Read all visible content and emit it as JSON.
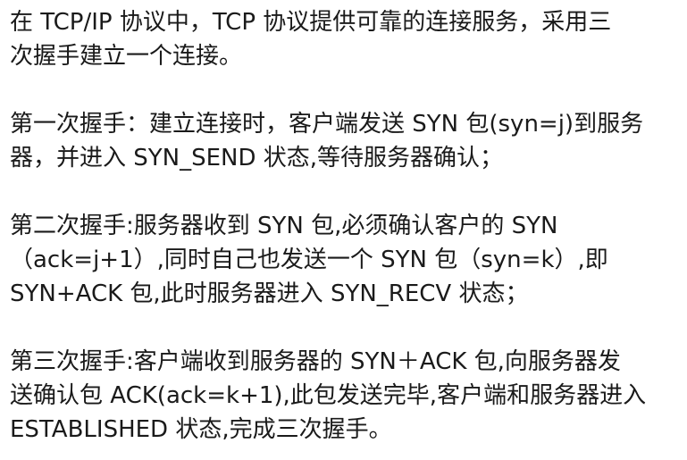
{
  "paragraphs": [
    {
      "lines": [
        "在 TCP/IP 协议中，TCP 协议提供可靠的连接服务，采用三",
        "次握手建立一个连接。"
      ]
    },
    {
      "lines": [
        "第一次握手：建立连接时，客户端发送 SYN 包(syn=j)到服务",
        "器，并进入 SYN_SEND 状态,等待服务器确认；"
      ]
    },
    {
      "lines": [
        "第二次握手:服务器收到 SYN 包,必须确认客户的 SYN",
        "（ack=j+1）,同时自己也发送一个 SYN 包（syn=k）,即",
        "SYN+ACK 包,此时服务器进入 SYN_RECV 状态；"
      ]
    },
    {
      "lines": [
        "第三次握手:客户端收到服务器的 SYN＋ACK 包,向服务器发",
        "送确认包 ACK(ack=k+1),此包发送完毕,客户端和服务器进入",
        "ESTABLISHED 状态,完成三次握手。"
      ]
    }
  ]
}
